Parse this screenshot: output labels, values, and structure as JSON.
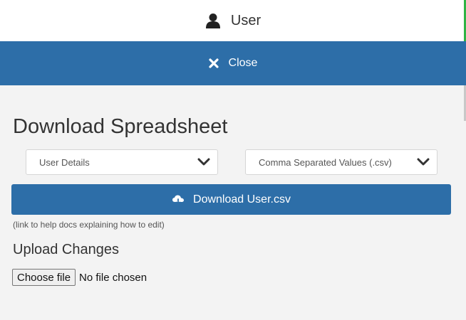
{
  "header": {
    "user_icon": "user-icon",
    "label": "User"
  },
  "close_bar": {
    "icon": "close-icon",
    "label": "Close"
  },
  "download_section": {
    "title": "Download Spreadsheet",
    "data_select": {
      "selected": "User Details"
    },
    "format_select": {
      "selected": "Comma Separated Values (.csv)"
    },
    "download_button": {
      "icon": "cloud-download-icon",
      "label": "Download User.csv"
    },
    "help_link": "(link to help docs explaining how to edit)"
  },
  "upload_section": {
    "title": "Upload Changes",
    "file_button": "Choose file",
    "file_status": "No file chosen"
  },
  "colors": {
    "primary": "#2d6ea8",
    "background": "#f3f3f3",
    "accent": "#2fb344"
  }
}
